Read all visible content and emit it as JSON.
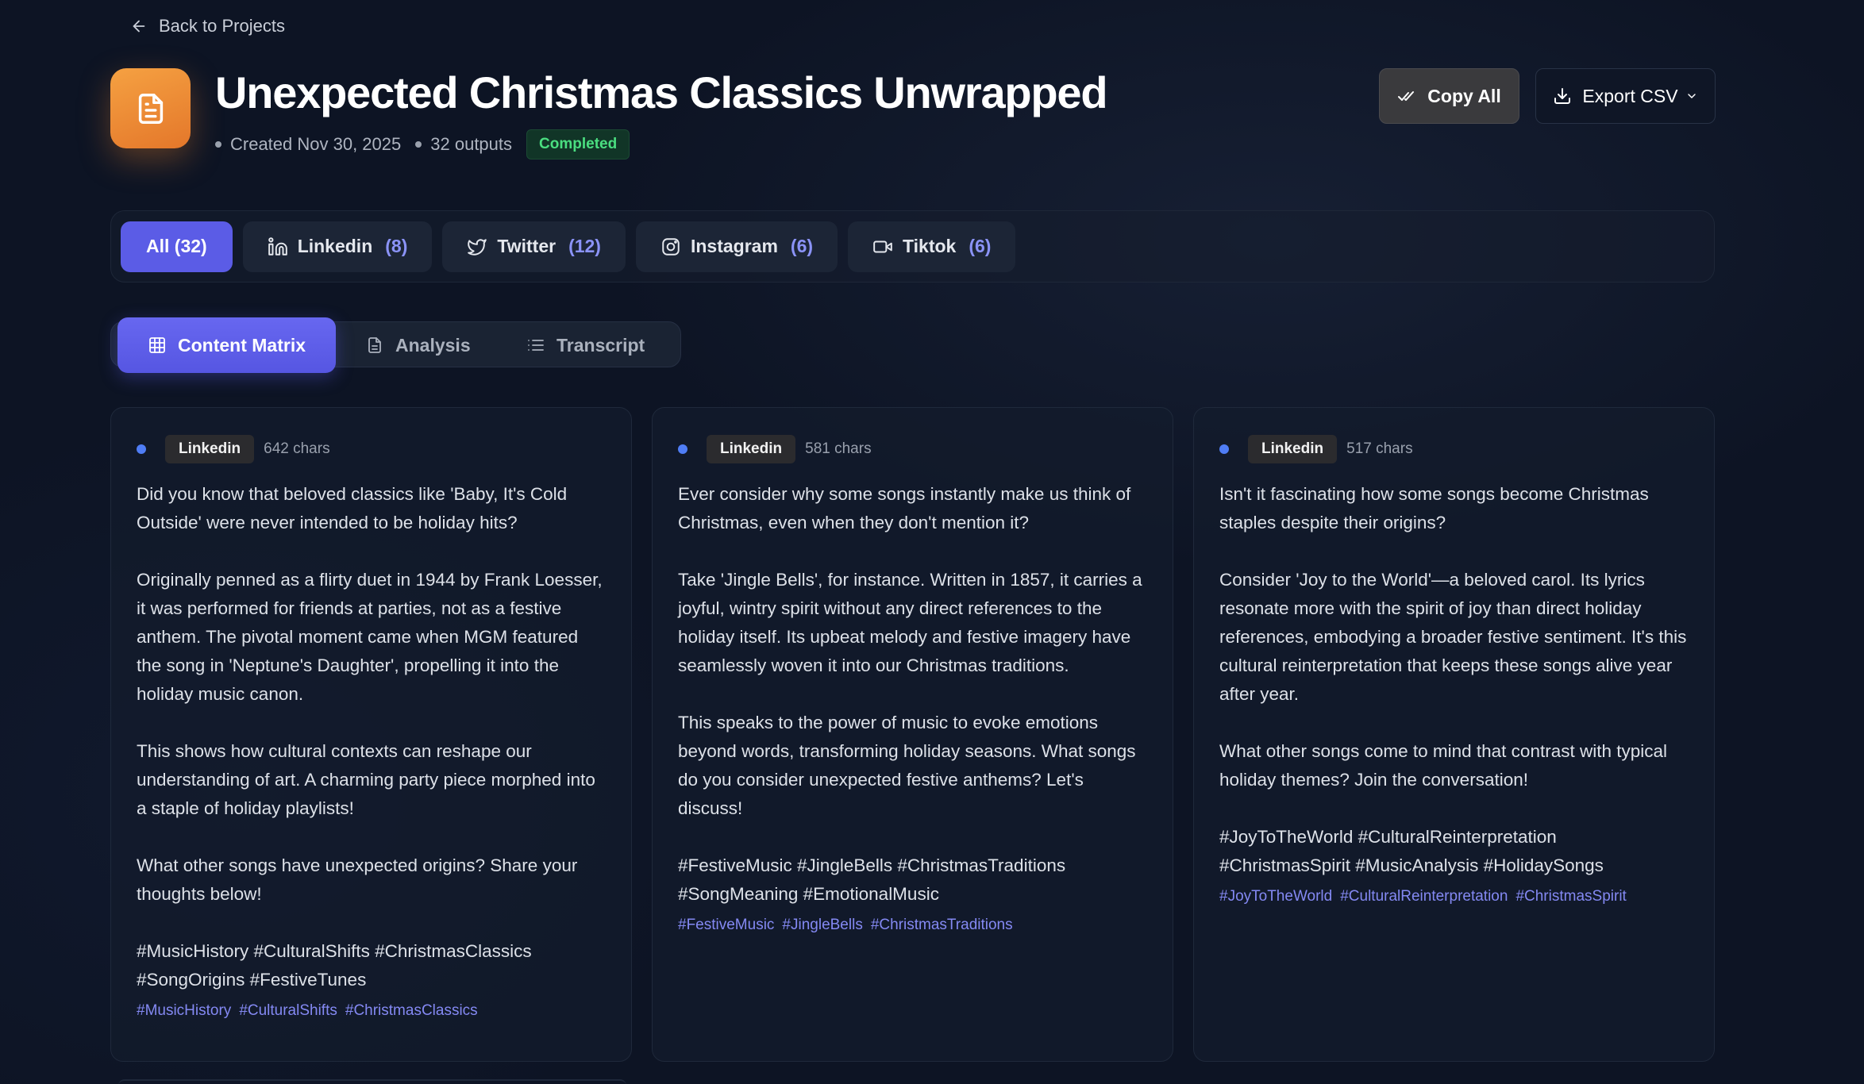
{
  "nav": {
    "back_label": "Back to Projects"
  },
  "header": {
    "title": "Unexpected Christmas Classics Unwrapped",
    "created": "Created Nov 30, 2025",
    "outputs": "32 outputs",
    "status": "Completed",
    "copy_label": "Copy All",
    "export_label": "Export CSV"
  },
  "filters": [
    {
      "label": "All (32)",
      "count": "",
      "icon": "none"
    },
    {
      "label": "Linkedin",
      "count": "(8)",
      "icon": "linkedin-icon"
    },
    {
      "label": "Twitter",
      "count": "(12)",
      "icon": "twitter-icon"
    },
    {
      "label": "Instagram",
      "count": "(6)",
      "icon": "instagram-icon"
    },
    {
      "label": "Tiktok",
      "count": "(6)",
      "icon": "video-icon"
    }
  ],
  "tabs": [
    {
      "label": "Content Matrix",
      "icon": "grid-icon"
    },
    {
      "label": "Analysis",
      "icon": "document-icon"
    },
    {
      "label": "Transcript",
      "icon": "list-icon"
    }
  ],
  "colors": {
    "accent": "#5b5ce6",
    "status_green": "#4ade80",
    "brand_orange": "#f08a33",
    "platform_dot": "#4f7df5",
    "hashtag": "#8489f3"
  },
  "cards": [
    {
      "platform": "Linkedin",
      "chars": "642 chars",
      "body": "Did you know that beloved classics like 'Baby, It's Cold Outside' were never intended to be holiday hits?\n\nOriginally penned as a flirty duet in 1944 by Frank Loesser, it was performed for friends at parties, not as a festive anthem. The pivotal moment came when MGM featured the song in 'Neptune's Daughter', propelling it into the holiday music canon.\n\nThis shows how cultural contexts can reshape our understanding of art. A charming party piece morphed into a staple of holiday playlists!\n\nWhat other songs have unexpected origins? Share your thoughts below!\n\n#MusicHistory #CulturalShifts #ChristmasClassics #SongOrigins #FestiveTunes",
      "tags": [
        "#MusicHistory",
        "#CulturalShifts",
        "#ChristmasClassics"
      ]
    },
    {
      "platform": "Linkedin",
      "chars": "581 chars",
      "body": "Ever consider why some songs instantly make us think of Christmas, even when they don't mention it?\n\nTake 'Jingle Bells', for instance. Written in 1857, it carries a joyful, wintry spirit without any direct references to the holiday itself. Its upbeat melody and festive imagery have seamlessly woven it into our Christmas traditions.\n\nThis speaks to the power of music to evoke emotions beyond words, transforming holiday seasons. What songs do you consider unexpected festive anthems? Let's discuss!\n\n#FestiveMusic #JingleBells #ChristmasTraditions #SongMeaning #EmotionalMusic",
      "tags": [
        "#FestiveMusic",
        "#JingleBells",
        "#ChristmasTraditions"
      ]
    },
    {
      "platform": "Linkedin",
      "chars": "517 chars",
      "body": "Isn't it fascinating how some songs become Christmas staples despite their origins?\n\nConsider 'Joy to the World'—a beloved carol. Its lyrics resonate more with the spirit of joy than direct holiday references, embodying a broader festive sentiment. It's this cultural reinterpretation that keeps these songs alive year after year.\n\nWhat other songs come to mind that contrast with typical holiday themes? Join the conversation!\n\n#JoyToTheWorld #CulturalReinterpretation #ChristmasSpirit #MusicAnalysis #HolidaySongs",
      "tags": [
        "#JoyToTheWorld",
        "#CulturalReinterpretation",
        "#ChristmasSpirit"
      ]
    }
  ]
}
